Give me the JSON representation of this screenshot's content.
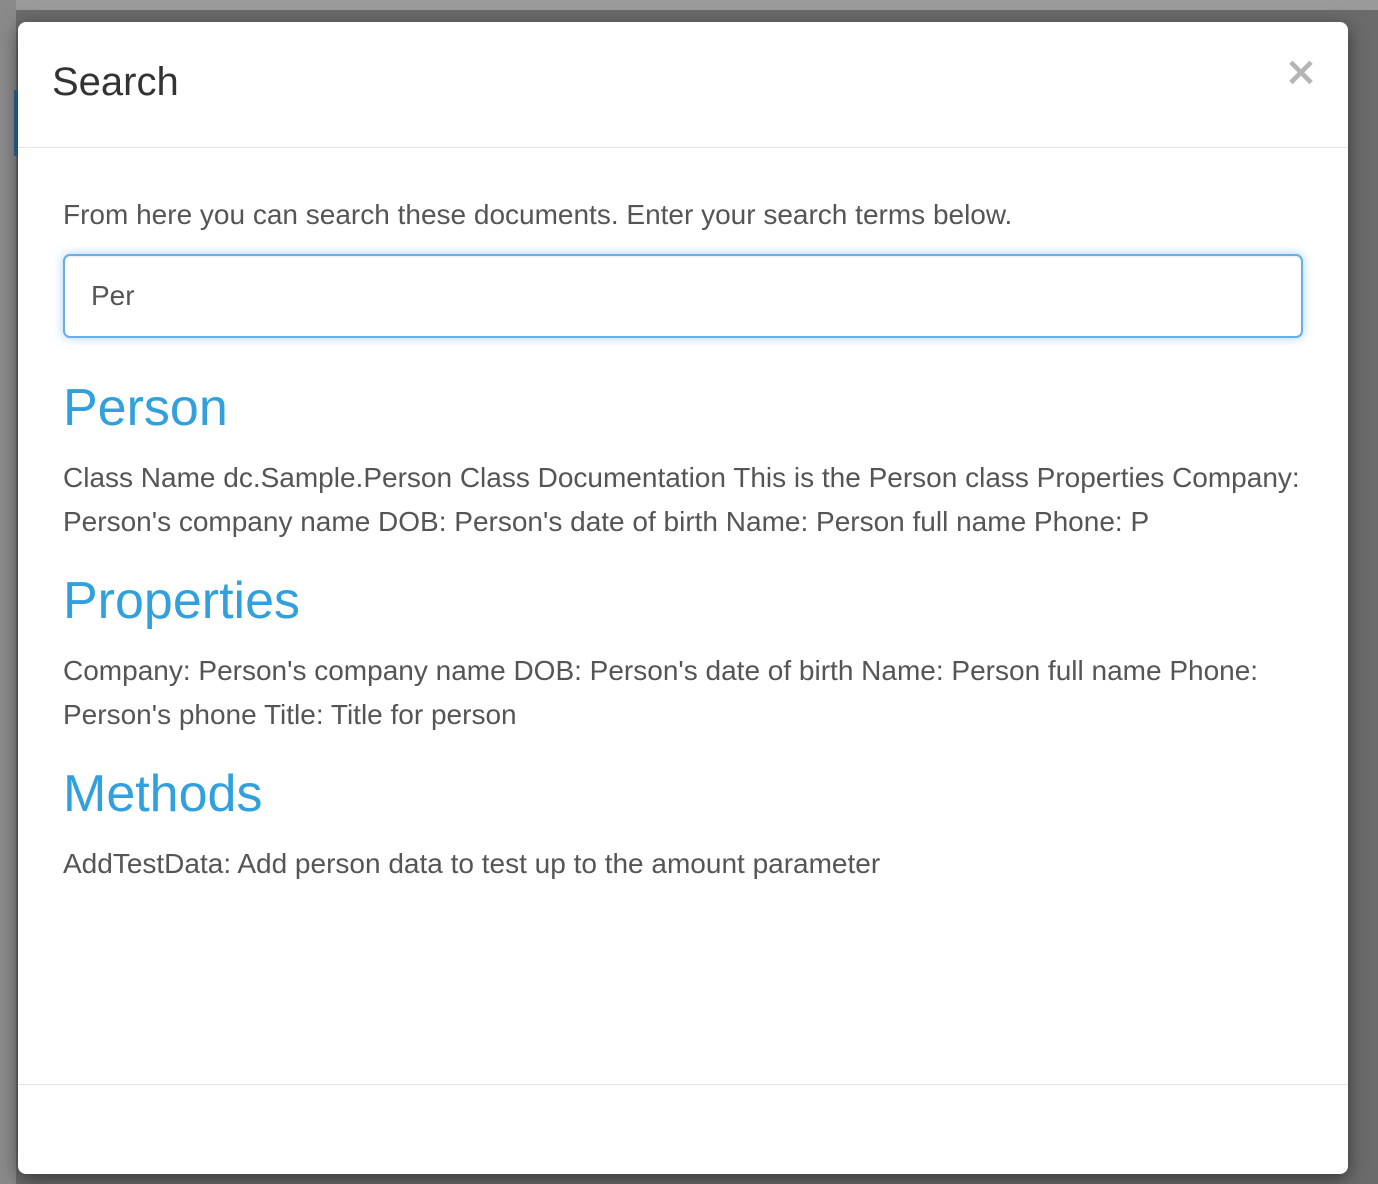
{
  "modal": {
    "title": "Search",
    "close_label": "×"
  },
  "search": {
    "intro": "From here you can search these documents. Enter your search terms below.",
    "value": "Per",
    "placeholder": ""
  },
  "results": [
    {
      "title": "Person",
      "description": "Class Name dc.Sample.Person Class Documentation This is the Person class Properties Company: Person's company name DOB: Person's date of birth Name: Person full name Phone: P"
    },
    {
      "title": "Properties",
      "description": "Company: Person's company name DOB: Person's date of birth Name: Person full name Phone: Person's phone Title: Title for person"
    },
    {
      "title": "Methods",
      "description": "AddTestData: Add person data to test up to the amount parameter"
    }
  ],
  "colors": {
    "link": "#31a0dd",
    "text": "#555555",
    "focus_border": "#66afe9"
  }
}
